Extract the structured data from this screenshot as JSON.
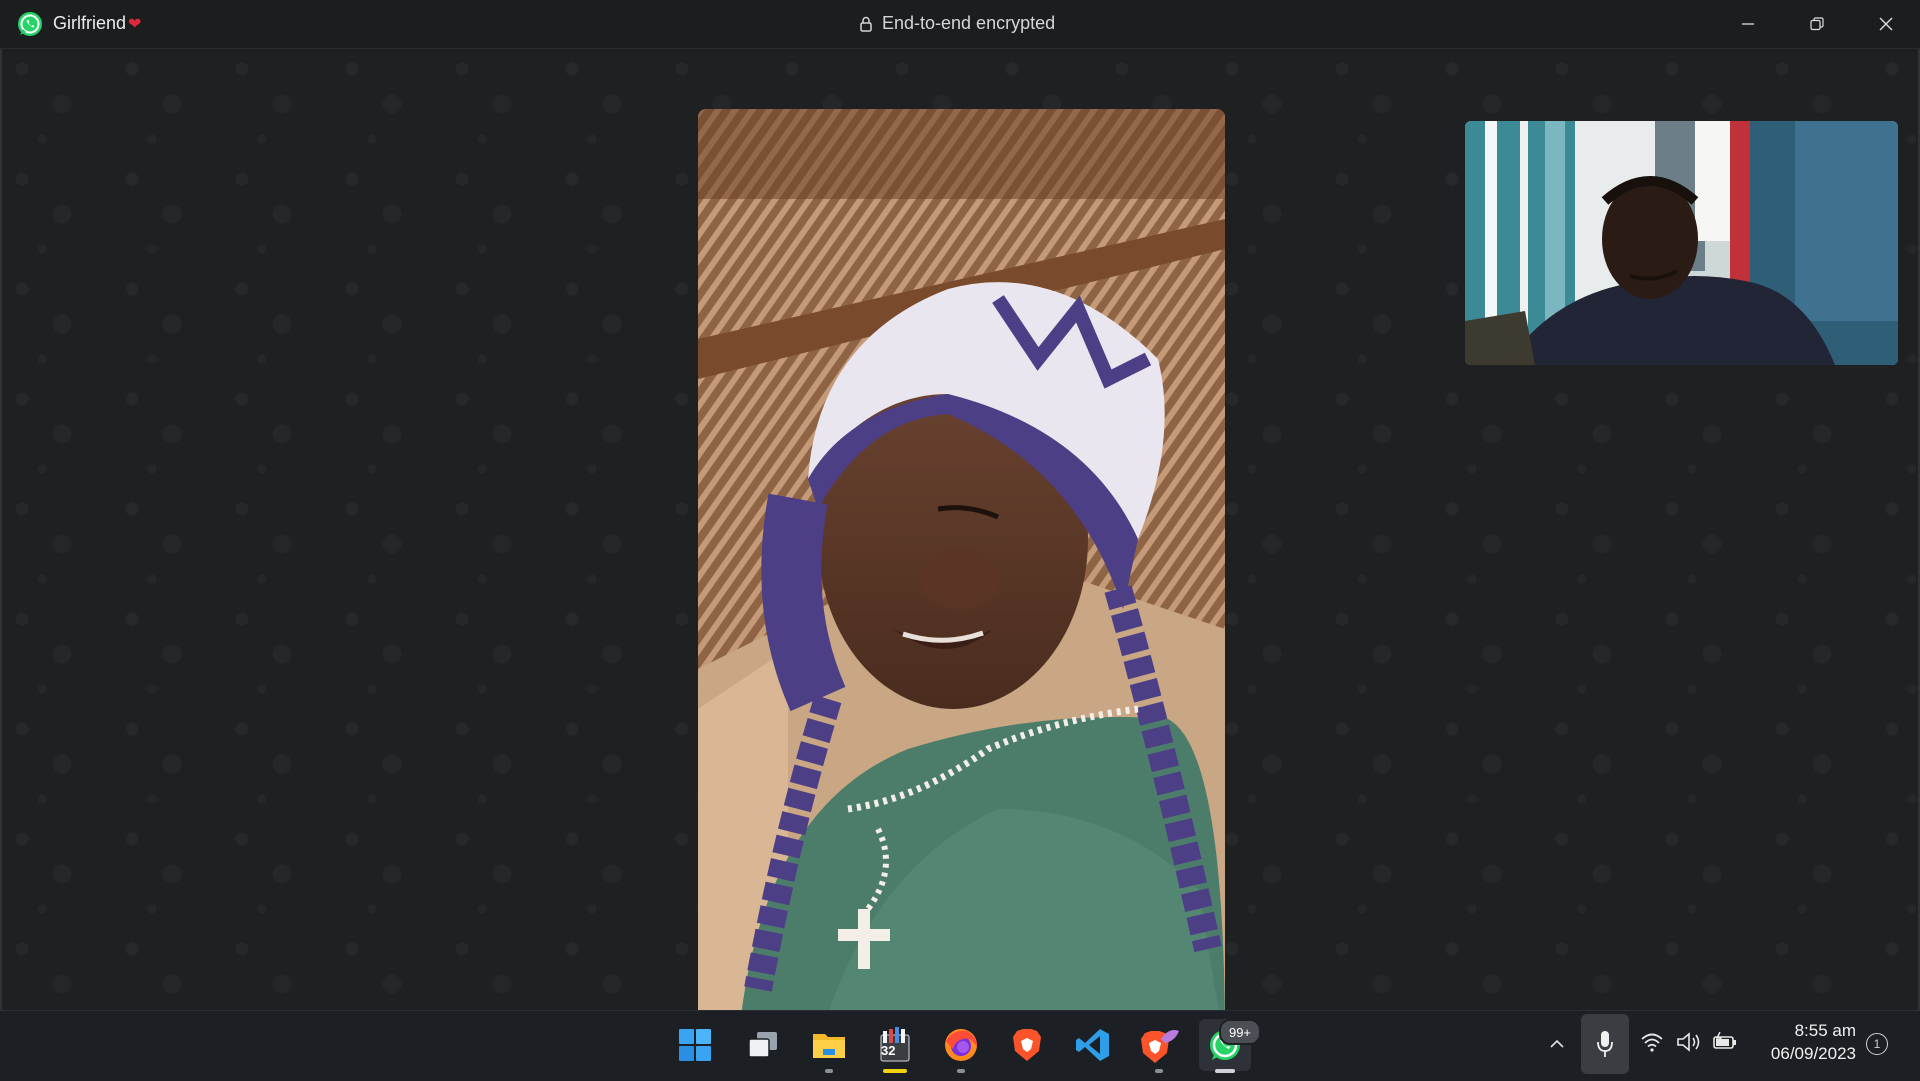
{
  "window": {
    "title": "Girlfriend",
    "title_emoji": "❤",
    "encryption_label": "End-to-end encrypted",
    "accent": "#25d366"
  },
  "call": {
    "remote_video": "remote-participant-video",
    "self_video": "self-preview-video"
  },
  "taskbar": {
    "apps": [
      {
        "name": "start-icon"
      },
      {
        "name": "task-view-icon"
      },
      {
        "name": "file-explorer-icon"
      },
      {
        "name": "media-app-icon"
      },
      {
        "name": "firefox-icon"
      },
      {
        "name": "brave-icon"
      },
      {
        "name": "vscode-icon"
      },
      {
        "name": "brave-beta-icon"
      },
      {
        "name": "whatsapp-icon"
      }
    ],
    "whatsapp_badge": "99+",
    "media_app_label": "32",
    "clock_time": "8:55 am",
    "clock_date": "06/09/2023",
    "notification_count": "1"
  }
}
